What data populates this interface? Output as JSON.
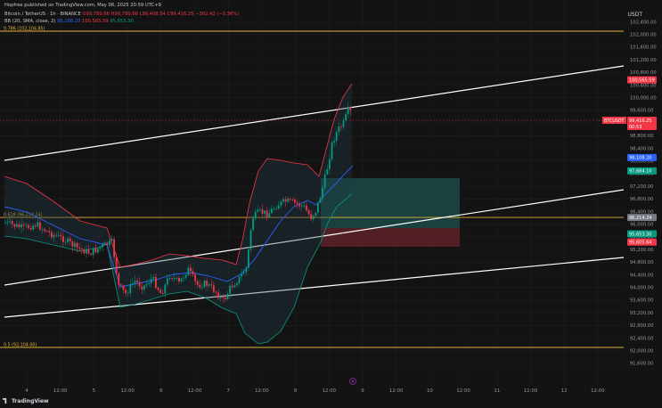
{
  "header": {
    "publisher": "Hopfree published on TradingView.com, May 08, 2025 20:59 UTC+9",
    "symbol": "Bitcoin / TetherUS · 1h · BINANCE",
    "ohlc": "O99,780.66 H99,780.66 L99,408.54 C99,416.25 −362.42 (−0.36%)",
    "bb_title": "BB (20, SMA, close, 2)",
    "bb_basis": "98,108.20",
    "bb_upper": "100,565.59",
    "bb_lower": "95,653.30",
    "currency": "USDT"
  },
  "price_axis": {
    "ticks": [
      "102,400.00",
      "102,000.00",
      "101,600.00",
      "101,200.00",
      "100,800.00",
      "100,400.00",
      "100,000.00",
      "99,600.00",
      "99,200.00",
      "98,800.00",
      "98,400.00",
      "98,000.00",
      "97,600.00",
      "97,200.00",
      "96,800.00",
      "96,400.00",
      "96,000.00",
      "95,600.00",
      "95,200.00",
      "94,800.00",
      "94,400.00",
      "94,000.00",
      "93,600.00",
      "93,200.00",
      "92,800.00",
      "92,400.00",
      "92,000.00",
      "91,600.00"
    ]
  },
  "time_axis": {
    "ticks": [
      "4",
      "12:00",
      "5",
      "12:00",
      "6",
      "12:00",
      "7",
      "12:00",
      "8",
      "12:00",
      "9",
      "12:00",
      "10",
      "12:00",
      "11",
      "12:00",
      "12",
      "12:00"
    ]
  },
  "fib_levels": [
    {
      "label": "0.786 (102,104.85)",
      "price": 102104.85
    },
    {
      "label": "0.5 (92,104.00)",
      "price": 92104.0
    }
  ],
  "level_mid_label": "0.618 (96,214.24)",
  "badges": {
    "bb_upper": "100,565.59",
    "btc_name": "BTCUSDT",
    "btc_price": "99,416.25",
    "btc_timer": "00:53",
    "bb_basis": "98,108.20",
    "target": "97,684.10",
    "entry": "96,214.24",
    "bb_lower": "95,653.30",
    "stop": "95,605.64"
  },
  "colors": {
    "bg": "#131313",
    "up": "#089981",
    "down": "#f23645",
    "basis": "#2962ff",
    "fib": "#e3b23c",
    "trend": "#ffffff",
    "target_zone": "#1c4a45",
    "stop_zone": "#5a2128"
  },
  "footer": {
    "logo": "TradingView"
  }
}
